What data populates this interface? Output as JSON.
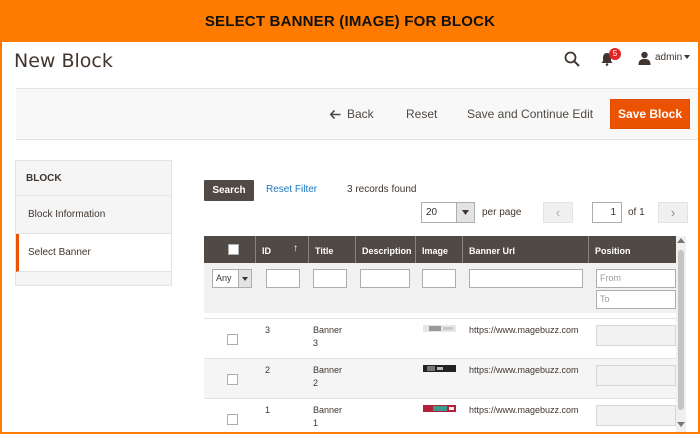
{
  "banner": {
    "title": "SELECT BANNER (IMAGE) FOR BLOCK",
    "color": "#ff7b00"
  },
  "header": {
    "page_title": "New Block",
    "notifications_count": "5",
    "user_name": "admin"
  },
  "actions": {
    "back_label": "Back",
    "reset_label": "Reset",
    "save_continue_label": "Save and Continue Edit",
    "save_label": "Save Block",
    "accent": "#eb5202"
  },
  "sidebar": {
    "title": "BLOCK",
    "items": [
      {
        "label": "Block Information"
      },
      {
        "label": "Select Banner"
      }
    ]
  },
  "grid_controls": {
    "search_label": "Search",
    "reset_filter_label": "Reset Filter",
    "records_found": "3 records found",
    "per_page_value": "20",
    "per_page_label": "per page",
    "current_page": "1",
    "page_of": "of 1"
  },
  "table": {
    "columns": [
      "ID",
      "Title",
      "Description",
      "Image",
      "Banner Url",
      "Position"
    ],
    "filters": {
      "any_value": "Any",
      "from_placeholder": "From",
      "to_placeholder": "To"
    },
    "rows": [
      {
        "id": "3",
        "title_line1": "Banner",
        "title_line2": "3",
        "url": "https://www.magebuzz.com"
      },
      {
        "id": "2",
        "title_line1": "Banner",
        "title_line2": "2",
        "url": "https://www.magebuzz.com"
      },
      {
        "id": "1",
        "title_line1": "Banner",
        "title_line2": "1",
        "url": "https://www.magebuzz.com"
      }
    ]
  }
}
